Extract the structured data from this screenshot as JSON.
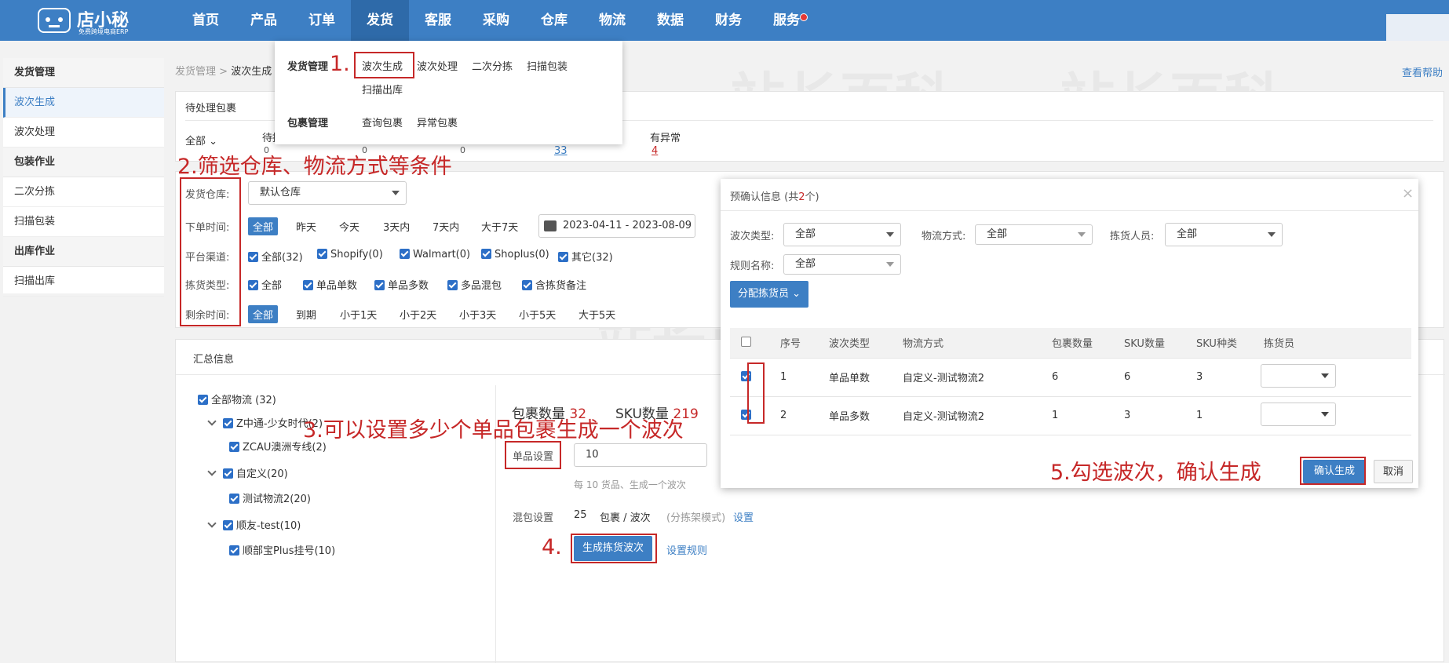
{
  "brand": {
    "name": "店小秘",
    "subtitle": "免费跨境电商ERP"
  },
  "nav": [
    "首页",
    "产品",
    "订单",
    "发货",
    "客服",
    "采购",
    "仓库",
    "物流",
    "数据",
    "财务",
    "服务"
  ],
  "sidebar": [
    {
      "type": "group",
      "label": "发货管理"
    },
    {
      "type": "item",
      "label": "波次生成",
      "active": true
    },
    {
      "type": "item",
      "label": "波次处理"
    },
    {
      "type": "group",
      "label": "包装作业"
    },
    {
      "type": "item",
      "label": "二次分拣"
    },
    {
      "type": "item",
      "label": "扫描包装"
    },
    {
      "type": "group",
      "label": "出库作业"
    },
    {
      "type": "item",
      "label": "扫描出库"
    }
  ],
  "breadcrumb": {
    "root": "发货管理",
    "sep": ">",
    "current": "波次生成"
  },
  "help": "查看帮助",
  "dropdown": {
    "group1": "发货管理",
    "g1_items": [
      "波次生成",
      "波次处理",
      "二次分拣",
      "扫描包装",
      "扫描出库"
    ],
    "group2": "包裹管理",
    "g2_items": [
      "查询包裹",
      "异常包裹"
    ]
  },
  "pending": {
    "title": "待处理包裹",
    "all": "全部",
    "col1": "待拣",
    "v1": "0",
    "v2": "0",
    "v3": "0",
    "v4": "33",
    "col5": "有异常",
    "v5": "4"
  },
  "filters": {
    "warehouse_label": "发货仓库:",
    "warehouse_value": "默认仓库",
    "order_time_label": "下单时间:",
    "order_time_opts": [
      "全部",
      "昨天",
      "今天",
      "3天内",
      "7天内",
      "大于7天"
    ],
    "date_range": "2023-04-11 - 2023-08-09",
    "channel_label": "平台渠道:",
    "channels": [
      "全部(32)",
      "Shopify(0)",
      "Walmart(0)",
      "Shoplus(0)",
      "其它(32)"
    ],
    "pick_type_label": "拣货类型:",
    "pick_types": [
      "全部",
      "单品单数",
      "单品多数",
      "多品混包",
      "含拣货备注"
    ],
    "remain_label": "剩余时间:",
    "remain_opts": [
      "全部",
      "到期",
      "小于1天",
      "小于2天",
      "小于3天",
      "小于5天",
      "大于5天"
    ]
  },
  "summary": {
    "title": "汇总信息",
    "tree": [
      "全部物流 (32)",
      "Z中通-少女时代(2)",
      "ZCAU澳洲专线(2)",
      "自定义(20)",
      "测试物流2(20)",
      "顺友-test(10)",
      "顺部宝Plus挂号(10)"
    ],
    "pkg_label": "包裹数量",
    "pkg_count": "32",
    "sku_label": "SKU数量",
    "sku_count": "219",
    "single_label": "单品设置",
    "single_value": "10",
    "single_hint": "每 10 货品、生成一个波次",
    "mix_label": "混包设置",
    "mix_value": "25",
    "mix_unit": "包裹 / 波次",
    "mix_note": "(分拣架模式)",
    "mix_link": "设置",
    "gen_button": "生成拣货波次",
    "rule_link": "设置规则"
  },
  "modal": {
    "title": "预确认信息 (共",
    "count": "2",
    "title_end": "个)",
    "close": "×",
    "batch_type_label": "波次类型:",
    "batch_type_value": "全部",
    "logistics_label": "物流方式:",
    "logistics_value": "全部",
    "picker_label": "拣货人员:",
    "picker_value": "全部",
    "rule_label": "规则名称:",
    "rule_value": "全部",
    "assign_button": "分配拣货员",
    "columns": [
      "序号",
      "波次类型",
      "物流方式",
      "包裹数量",
      "SKU数量",
      "SKU种类",
      "拣货员"
    ],
    "rows": [
      {
        "no": "1",
        "type": "单品单数",
        "logistics": "自定义-测试物流2",
        "pkg": "6",
        "sku": "6",
        "kinds": "3"
      },
      {
        "no": "2",
        "type": "单品多数",
        "logistics": "自定义-测试物流2",
        "pkg": "1",
        "sku": "3",
        "kinds": "1"
      }
    ],
    "confirm_button": "确认生成",
    "cancel_button": "取消"
  },
  "annotations": {
    "a1": "1.",
    "a2": "2.筛选仓库、物流方式等条件",
    "a3": "3.可以设置多少个单品包裹生成一个波次",
    "a4": "4.",
    "a5": "5.勾选波次，确认生成"
  },
  "watermark": "站长百科",
  "colors": {
    "primary": "#3d7fc4",
    "annotation": "#c62828",
    "checkbox": "#2c6fc7"
  }
}
